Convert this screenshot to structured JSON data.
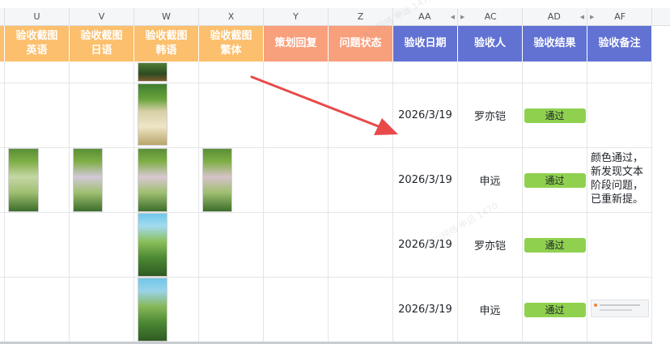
{
  "columns": [
    {
      "letter": "U"
    },
    {
      "letter": "V"
    },
    {
      "letter": "W"
    },
    {
      "letter": "X"
    },
    {
      "letter": "Y"
    },
    {
      "letter": "Z"
    },
    {
      "letter": "AA"
    },
    {
      "letter": "AC"
    },
    {
      "letter": "AD"
    },
    {
      "letter": "AF"
    }
  ],
  "headers": {
    "u_line1": "验收截图",
    "u_line2": "英语",
    "v_line1": "验收截图",
    "v_line2": "日语",
    "w_line1": "验收截图",
    "w_line2": "韩语",
    "x_line1": "验收截图",
    "x_line2": "繁体",
    "y": "策划回复",
    "z": "问题状态",
    "aa": "验收日期",
    "ac": "验收人",
    "ad": "验收结果",
    "af": "验收备注"
  },
  "rows": [
    {
      "date": "2026/3/19",
      "person": "罗亦铠",
      "result": "通过",
      "note": ""
    },
    {
      "date": "2026/3/19",
      "person": "申远",
      "result": "通过",
      "note": "颜色通过，\n新发现文本\n阶段问题，\n已重新提。"
    },
    {
      "date": "2026/3/19",
      "person": "罗亦铠",
      "result": "通过",
      "note": ""
    },
    {
      "date": "2026/3/19",
      "person": "申远",
      "result": "通过",
      "note": ""
    }
  ],
  "colors": {
    "header_orange": "#fbbf6d",
    "header_salmon": "#f89f7c",
    "header_blue": "#6172d3",
    "pass_badge": "#8fd14f",
    "arrow": "#e84a4a"
  },
  "watermark": "冰川网络 申远 1470"
}
